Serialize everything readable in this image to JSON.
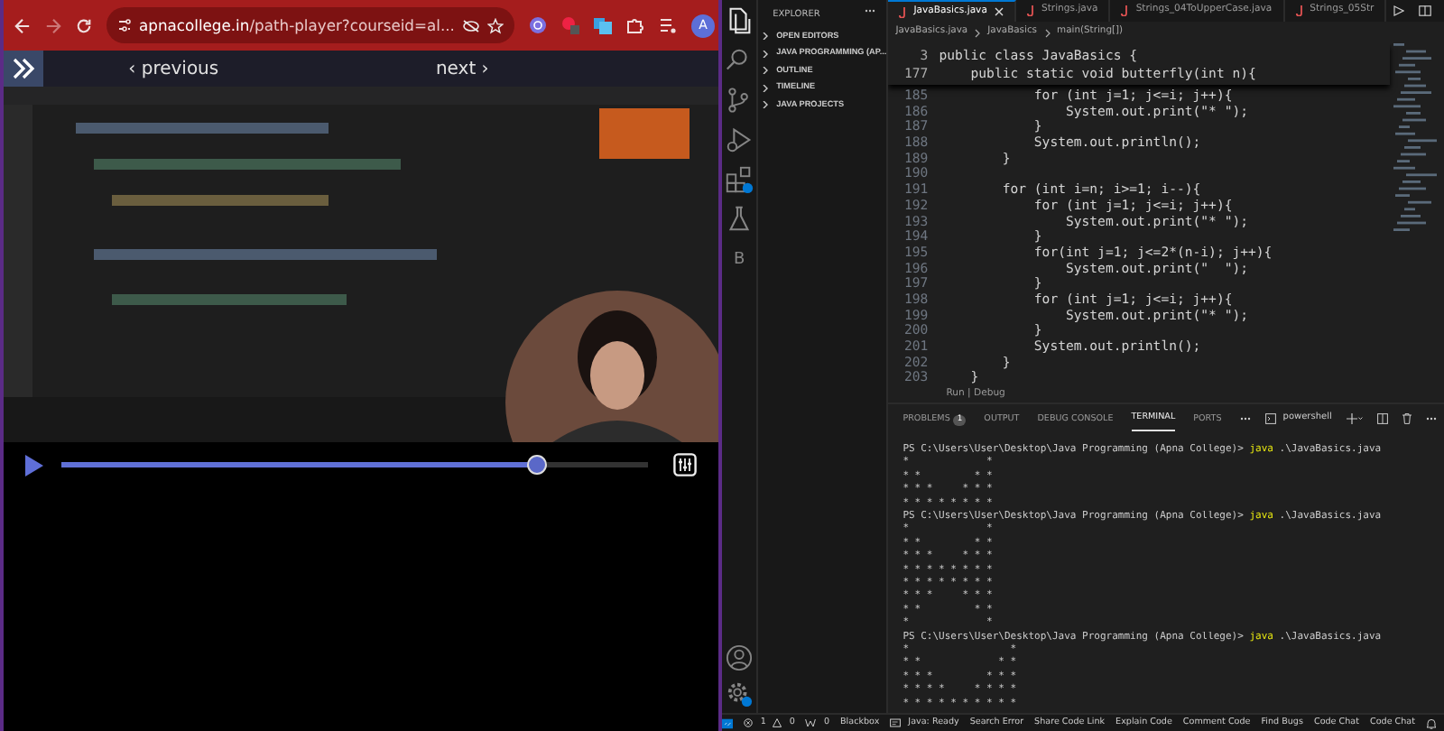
{
  "browser": {
    "url": "**apnacollege.in**/path-player?courseid=al...",
    "avatar": "A"
  },
  "course_nav": {
    "previous": "‹ previous",
    "next": "next ›"
  },
  "player": {
    "progress": {
      "level": 0.81
    }
  },
  "vscode": {
    "activity_bar": [
      {
        "kind": "files",
        "selected": true
      },
      {
        "kind": "search",
        "selected": false
      },
      {
        "kind": "source-control",
        "selected": false
      },
      {
        "kind": "run",
        "selected": false
      },
      {
        "kind": "extensions",
        "selected": false
      },
      {
        "kind": "testing",
        "selected": false
      },
      {
        "kind": "letter",
        "letter": "B",
        "selected": false
      }
    ],
    "sidebar": {
      "title": "EXPLORER",
      "sections": [
        {
          "label": "OPEN EDITORS",
          "expanded": false
        },
        {
          "label": "JAVA PROGRAMMING (AP...",
          "expanded": false
        },
        {
          "label": "OUTLINE",
          "expanded": false
        },
        {
          "label": "TIMELINE",
          "expanded": false
        },
        {
          "label": "JAVA PROJECTS",
          "expanded": false
        }
      ]
    },
    "tabs": [
      {
        "label": "JavaBasics.java",
        "selected": true
      },
      {
        "label": "Strings.java",
        "selected": false
      },
      {
        "label": "Strings_04ToUpperCase.java",
        "selected": false
      },
      {
        "label": "Strings_05Str",
        "selected": false
      }
    ],
    "breadcrumb": [
      "JavaBasics.java",
      "JavaBasics",
      "main(String[])"
    ],
    "sticky_lines": [
      {
        "number": "3",
        "code": "public class JavaBasics {"
      },
      {
        "number": "177",
        "code": "    public static void butterfly(int n){"
      }
    ],
    "code_lines": [
      {
        "number": "185",
        "code": "            for (int j=1; j<=i; j++){"
      },
      {
        "number": "186",
        "code": "                System.out.print(\"* \");"
      },
      {
        "number": "187",
        "code": "            }"
      },
      {
        "number": "188",
        "code": "            System.out.println();"
      },
      {
        "number": "189",
        "code": "        }"
      },
      {
        "number": "190"
      },
      {
        "number": "191",
        "code": "        for (int i=n; i>=1; i--){"
      },
      {
        "number": "192",
        "code": "            for (int j=1; j<=i; j++){"
      },
      {
        "number": "193",
        "code": "                System.out.print(\"* \");"
      },
      {
        "number": "194",
        "code": "            }"
      },
      {
        "number": "195",
        "code": "            for(int j=1; j<=2*(n-i); j++){"
      },
      {
        "number": "196",
        "code": "                System.out.print(\"  \");"
      },
      {
        "number": "197",
        "code": "            }"
      },
      {
        "number": "198",
        "code": "            for (int j=1; j<=i; j++){"
      },
      {
        "number": "199",
        "code": "                System.out.print(\"* \");"
      },
      {
        "number": "200",
        "code": "            }"
      },
      {
        "number": "201",
        "code": "            System.out.println();"
      },
      {
        "number": "202",
        "code": "        }"
      },
      {
        "number": "203",
        "code": "    }"
      }
    ],
    "codelens": "Run | Debug",
    "panel_tabs": [
      {
        "label": "PROBLEMS",
        "badge": "1",
        "selected": false
      },
      {
        "label": "OUTPUT",
        "selected": false
      },
      {
        "label": "DEBUG CONSOLE",
        "selected": false
      },
      {
        "label": "TERMINAL",
        "selected": true
      },
      {
        "label": "PORTS",
        "selected": false
      }
    ],
    "terminal_name": "powershell",
    "terminal_runs": [
      {
        "path": "PS C:\\Users\\User\\Desktop\\Java Programming (Apna College)>",
        "command": "java",
        "args": ".\\JavaBasics.java",
        "output": "*             *\n* *         * *\n* * *     * * *\n* * * * * * * *"
      },
      {
        "path": "PS C:\\Users\\User\\Desktop\\Java Programming (Apna College)>",
        "command": "java",
        "args": ".\\JavaBasics.java",
        "output": "*             *\n* *         * *\n* * *     * * *\n* * * * * * * *\n* * * * * * * *\n* * *     * * *\n* *         * *\n*             *"
      },
      {
        "path": "PS C:\\Users\\User\\Desktop\\Java Programming (Apna College)>",
        "command": "java",
        "args": ".\\JavaBasics.java",
        "output": "*                 *\n* *             * *\n* * *         * * *\n* * * *     * * * *\n* * * * * * * * * *"
      }
    ],
    "status_bar": [
      {
        "kind": "problems",
        "errors": "1",
        "warnings": "0"
      },
      {
        "kind": "ports",
        "text": "0"
      },
      {
        "kind": "text",
        "text": "Blackbox"
      },
      {
        "kind": "java",
        "text": "Java: Ready"
      },
      {
        "kind": "text",
        "text": "Search Error"
      },
      {
        "kind": "text",
        "text": "Share Code Link"
      },
      {
        "kind": "text",
        "text": "Explain Code"
      },
      {
        "kind": "text",
        "text": "Comment Code"
      },
      {
        "kind": "text",
        "text": "Find Bugs"
      },
      {
        "kind": "text",
        "text": "Code Chat"
      },
      {
        "kind": "text",
        "text": "Code Chat"
      }
    ]
  }
}
